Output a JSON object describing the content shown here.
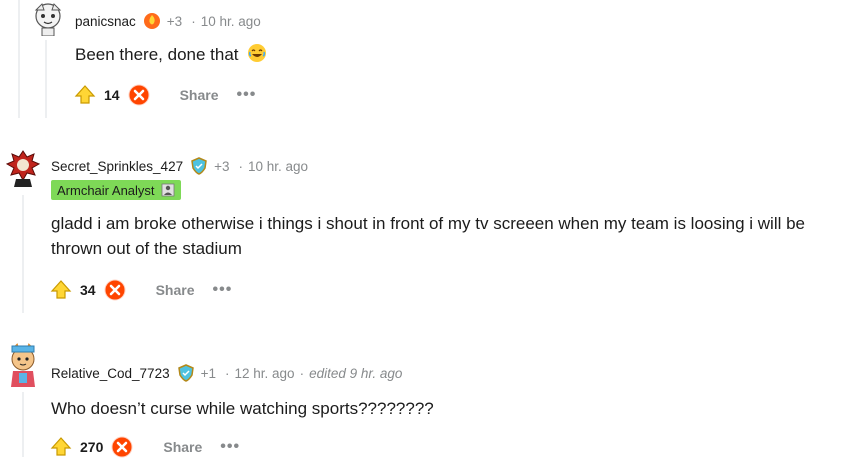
{
  "comments": [
    {
      "author": "panicsnac",
      "karma_plus": "+3",
      "time": "10 hr. ago",
      "body": "Been there, done that",
      "emoji_icon": "laughing-face-icon",
      "votes": "14",
      "share_label": "Share",
      "more_label": "•••"
    },
    {
      "author": "Secret_Sprinkles_427",
      "karma_plus": "+3",
      "time": "10 hr. ago",
      "flair": "Armchair Analyst",
      "body": "gladd i am broke otherwise i things i shout in front of my tv screeen when my team is loosing i will be thrown out of the stadium",
      "votes": "34",
      "share_label": "Share",
      "more_label": "•••"
    },
    {
      "author": "Relative_Cod_7723",
      "karma_plus": "+1",
      "time": "12 hr. ago",
      "edited": "edited 9 hr. ago",
      "body": "Who doesn’t curse while watching sports????????",
      "votes": "270",
      "share_label": "Share",
      "more_label": "•••"
    }
  ],
  "colors": {
    "upvote_fill": "#ffd635",
    "downvote_fill": "#ff4500",
    "flair_bg": "#7ed957",
    "meta_gray": "#878a8c"
  }
}
